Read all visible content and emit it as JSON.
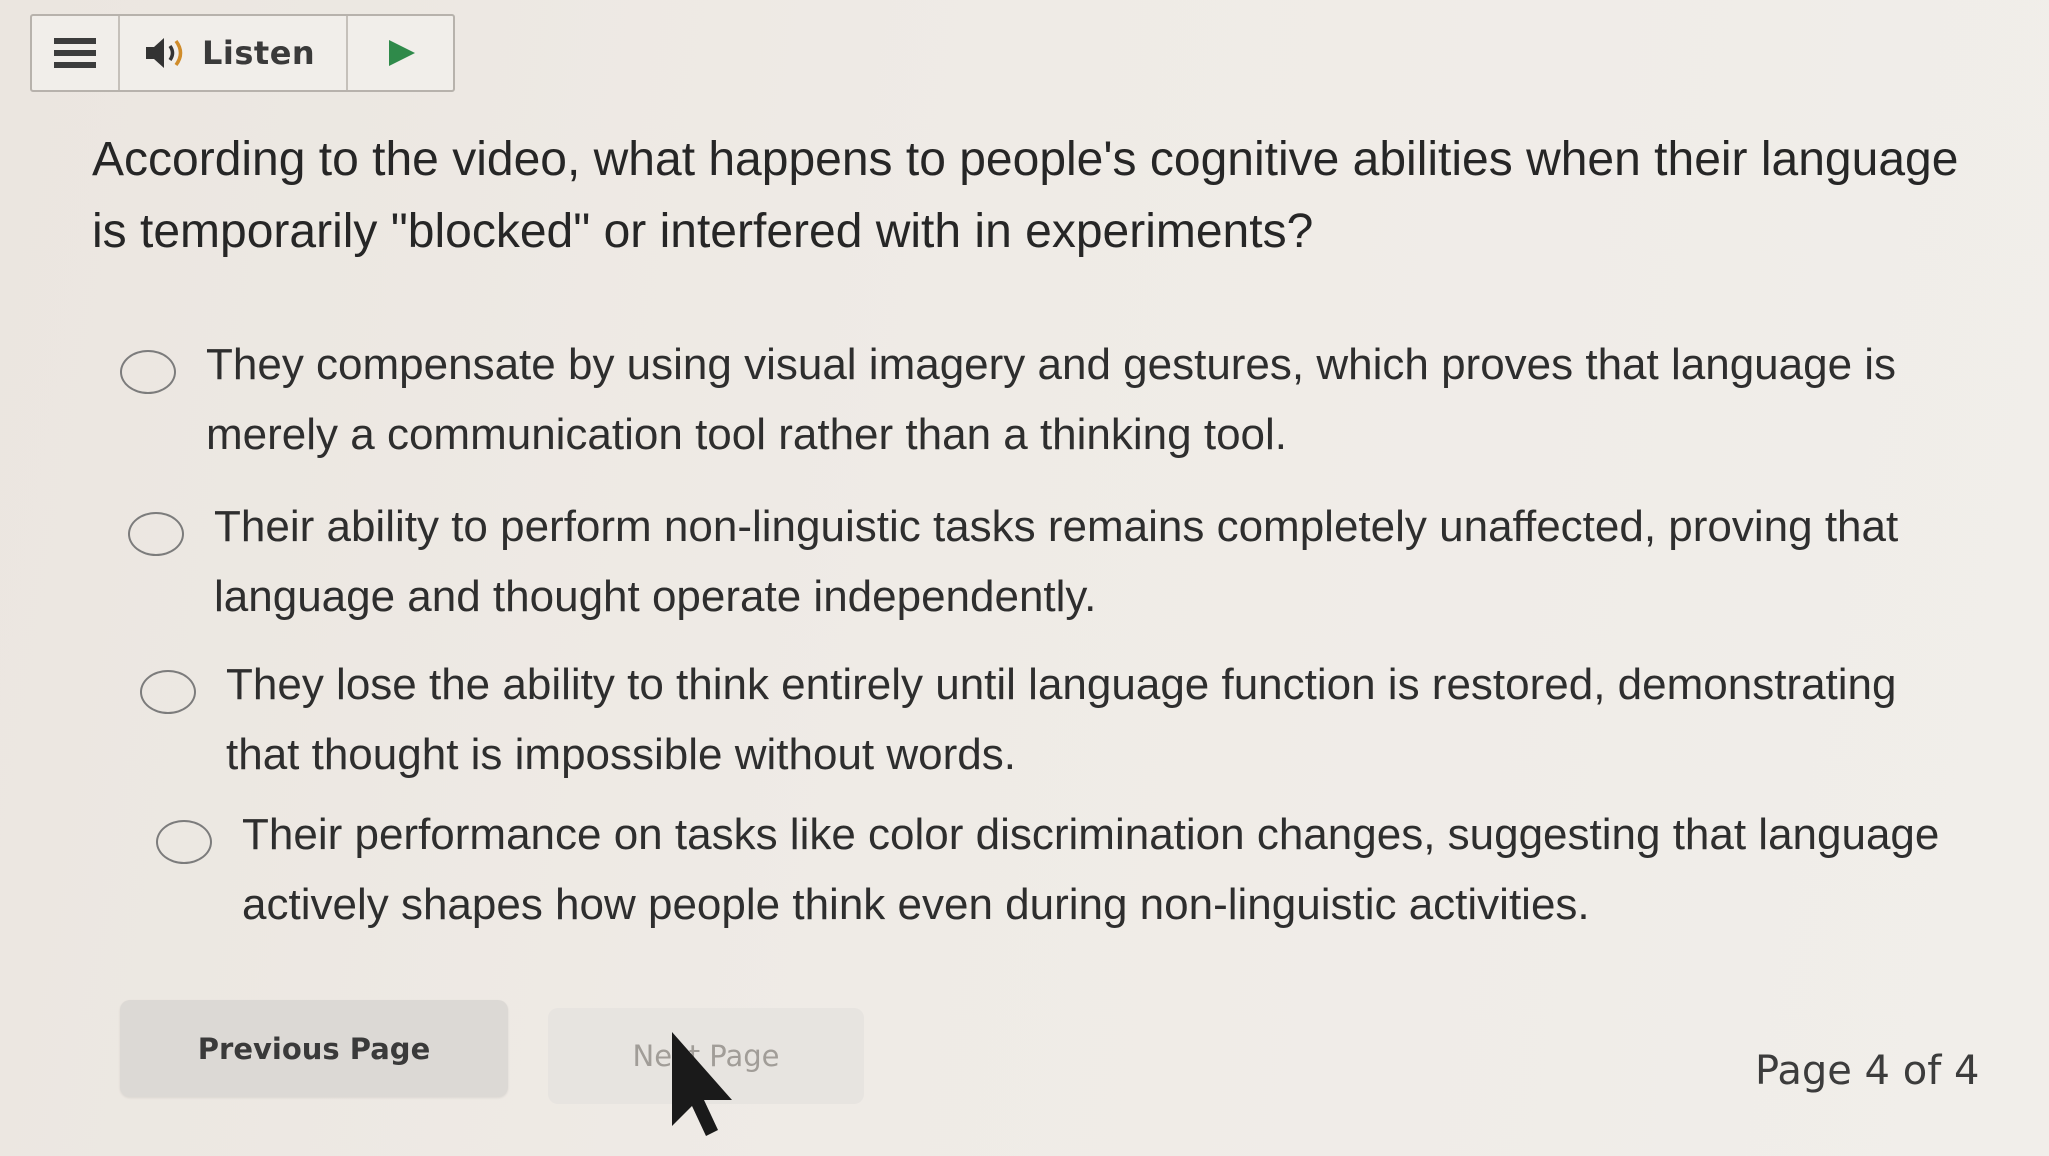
{
  "toolbar": {
    "menu_icon": "hamburger-menu-icon",
    "speaker_icon": "speaker-icon",
    "listen_label": "Listen",
    "play_icon": "play-icon",
    "accent_color": "#2f8a4a"
  },
  "question": {
    "text": "According to the video, what happens to people's cognitive abilities when their language is temporarily \"blocked\" or interfered with in experiments?"
  },
  "options": [
    {
      "text": "They compensate by using visual imagery and gestures, which proves that language is merely a communication tool rather than a thinking tool.",
      "selected": false
    },
    {
      "text": "Their ability to perform non-linguistic tasks remains completely unaffected, proving that language and thought operate independently.",
      "selected": false
    },
    {
      "text": "They lose the ability to think entirely until language function is restored, demonstrating that thought is impossible without words.",
      "selected": false
    },
    {
      "text": "Their performance on tasks like color discrimination changes, suggesting that language actively shapes how people think even during non-linguistic activities.",
      "selected": false
    }
  ],
  "navigation": {
    "previous_label": "Previous Page",
    "next_label": "Next Page",
    "page_indicator": "Page 4 of 4",
    "next_enabled": false
  },
  "cursor_icon": "mouse-pointer-icon"
}
